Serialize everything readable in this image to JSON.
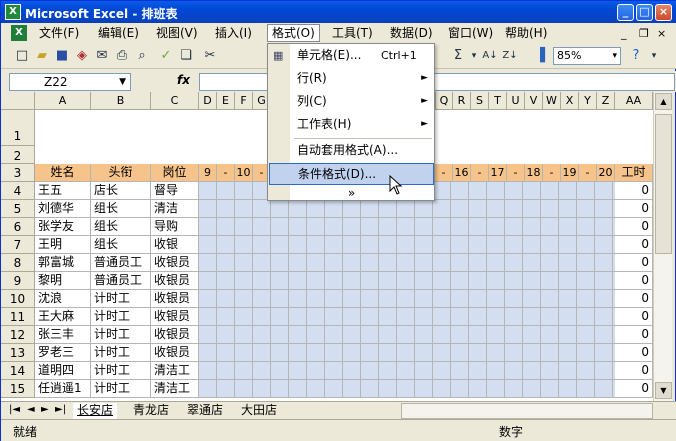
{
  "window": {
    "title": "Microsoft Excel - 排班表"
  },
  "menubar": {
    "items": [
      "文件(F)",
      "编辑(E)",
      "视图(V)",
      "插入(I)",
      "格式(O)",
      "工具(T)",
      "数据(D)",
      "窗口(W)",
      "帮助(H)"
    ],
    "active": "格式(O)"
  },
  "toolbar": {
    "zoom": "85%"
  },
  "formula": {
    "name_box": "Z22",
    "fx": "fx"
  },
  "columns": [
    "A",
    "B",
    "C",
    "D",
    "E",
    "F",
    "G",
    "Q",
    "R",
    "S",
    "T",
    "U",
    "V",
    "W",
    "X",
    "Y",
    "Z",
    "AA"
  ],
  "rows": [
    "1",
    "2",
    "3",
    "4",
    "5",
    "6",
    "7",
    "8",
    "9",
    "10",
    "11",
    "12",
    "13",
    "14",
    "15"
  ],
  "header_row": {
    "name": "姓名",
    "title": "头衔",
    "post": "岗位",
    "worktime": "工时"
  },
  "hours_left": [
    "9",
    "-",
    "10",
    "-"
  ],
  "hours_right": [
    "-",
    "16",
    "-",
    "17",
    "-",
    "18",
    "-",
    "19",
    "-",
    "20"
  ],
  "staff": [
    {
      "name": "王五",
      "title": "店长",
      "post": "督导",
      "hours": "0"
    },
    {
      "name": "刘德华",
      "title": "组长",
      "post": "清洁",
      "hours": "0"
    },
    {
      "name": "张学友",
      "title": "组长",
      "post": "导购",
      "hours": "0"
    },
    {
      "name": "王明",
      "title": "组长",
      "post": "收银",
      "hours": "0"
    },
    {
      "name": "郭富城",
      "title": "普通员工",
      "post": "收银员",
      "hours": "0"
    },
    {
      "name": "黎明",
      "title": "普通员工",
      "post": "收银员",
      "hours": "0"
    },
    {
      "name": "沈浪",
      "title": "计时工",
      "post": "收银员",
      "hours": "0"
    },
    {
      "name": "王大麻",
      "title": "计时工",
      "post": "收银员",
      "hours": "0"
    },
    {
      "name": "张三丰",
      "title": "计时工",
      "post": "收银员",
      "hours": "0"
    },
    {
      "name": "罗老三",
      "title": "计时工",
      "post": "收银员",
      "hours": "0"
    },
    {
      "name": "道明四",
      "title": "计时工",
      "post": "清洁工",
      "hours": "0"
    },
    {
      "name": "任逍遥1",
      "title": "计时工",
      "post": "清洁工",
      "hours": "0"
    }
  ],
  "format_menu": {
    "cells": "单元格(E)...",
    "cells_shortcut": "Ctrl+1",
    "row": "行(R)",
    "column": "列(C)",
    "sheet": "工作表(H)",
    "autoformat": "自动套用格式(A)...",
    "conditional": "条件格式(D)...",
    "more": "»"
  },
  "sheet_tabs": [
    "长安店",
    "青龙店",
    "翠通店",
    "大田店"
  ],
  "status": {
    "left": "就绪",
    "right": "数字"
  },
  "colors": {
    "title_bar": "#0046d5",
    "header_fill": "#f6c48b",
    "grid_fill": "#d3dff0",
    "menu_highlight": "#c1d2ee"
  }
}
